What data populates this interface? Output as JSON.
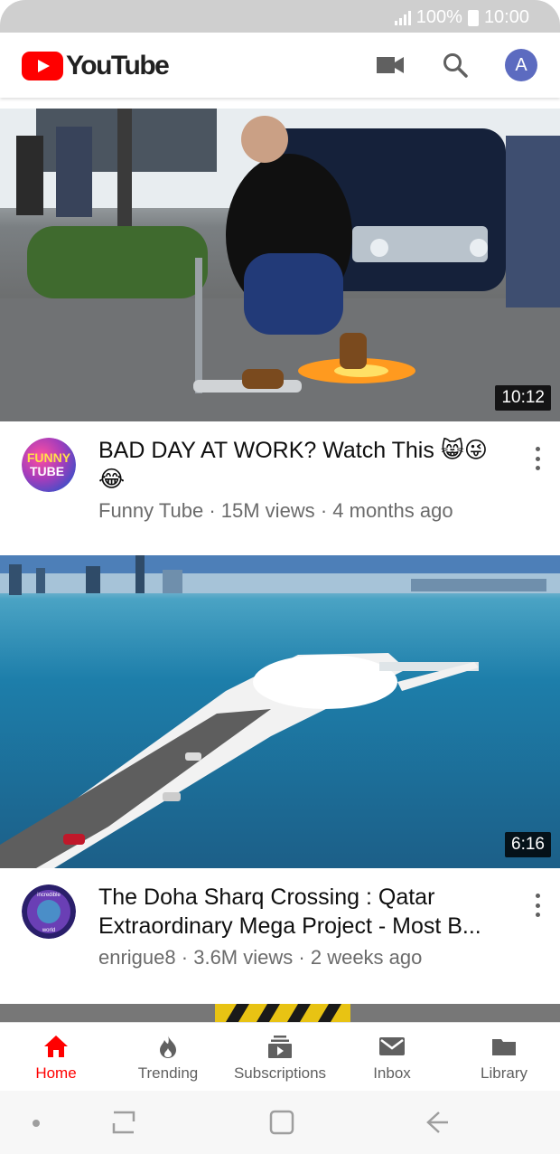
{
  "status_bar": {
    "battery": "100%",
    "time": "10:00"
  },
  "app": {
    "name": "YouTube",
    "account_initial": "A"
  },
  "videos": [
    {
      "title": "BAD DAY AT WORK? Watch This 😸😜😂",
      "channel": "Funny Tube",
      "views": "15M views",
      "age": "4 months ago",
      "duration": "10:12",
      "channel_avatar_text": [
        "FUNNY",
        "TUBE"
      ]
    },
    {
      "title": "The Doha Sharq Crossing :  Qatar Extraordinary Mega Project - Most B...",
      "channel": "enrigue8",
      "views": "3.6M views",
      "age": "2 weeks ago",
      "duration": "6:16",
      "channel_avatar_text": [
        "incredible",
        "world"
      ]
    }
  ],
  "bottom_nav": [
    {
      "label": "Home",
      "icon": "home-icon",
      "active": true
    },
    {
      "label": "Trending",
      "icon": "flame-icon",
      "active": false
    },
    {
      "label": "Subscriptions",
      "icon": "subscriptions-icon",
      "active": false
    },
    {
      "label": "Inbox",
      "icon": "mail-icon",
      "active": false
    },
    {
      "label": "Library",
      "icon": "folder-icon",
      "active": false
    }
  ],
  "colors": {
    "brand_red": "#ff0000",
    "avatar_bg": "#5c6bc0",
    "secondary_text": "#606060"
  }
}
